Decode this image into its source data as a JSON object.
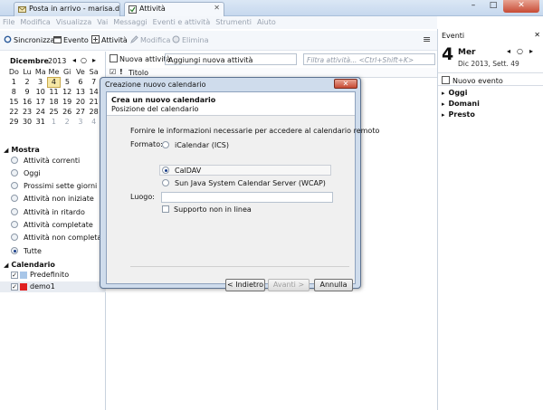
{
  "tabs": [
    {
      "label": "Posta in arrivo - marisa.dalla..."
    },
    {
      "label": "Attività"
    }
  ],
  "menubar": [
    "File",
    "Modifica",
    "Visualizza",
    "Vai",
    "Messaggi",
    "Eventi e attività",
    "Strumenti",
    "Aiuto"
  ],
  "toolbar": {
    "sync": "Sincronizza",
    "event": "Evento",
    "task": "Attività",
    "edit": "Modifica",
    "delete": "Elimina"
  },
  "minical": {
    "month": "Dicembre",
    "year": "2013",
    "weekdays": [
      "Do",
      "Lu",
      "Ma",
      "Me",
      "Gi",
      "Ve",
      "Sa"
    ],
    "weeks": [
      [
        "1",
        "2",
        "3",
        "4",
        "5",
        "6",
        "7"
      ],
      [
        "8",
        "9",
        "10",
        "11",
        "12",
        "13",
        "14"
      ],
      [
        "15",
        "16",
        "17",
        "18",
        "19",
        "20",
        "21"
      ],
      [
        "22",
        "23",
        "24",
        "25",
        "26",
        "27",
        "28"
      ],
      [
        "29",
        "30",
        "31",
        "1",
        "2",
        "3",
        "4"
      ]
    ],
    "today": "4"
  },
  "show": {
    "heading": "Mostra",
    "options": [
      "Attività correnti",
      "Oggi",
      "Prossimi sette giorni",
      "Attività non iniziate",
      "Attività in ritardo",
      "Attività completate",
      "Attività non completate",
      "Tutte"
    ],
    "selected": "Tutte"
  },
  "calendars": {
    "heading": "Calendario",
    "items": [
      {
        "name": "Predefinito",
        "color": "#a8c6e8"
      },
      {
        "name": "demo1",
        "color": "#e02020"
      }
    ]
  },
  "tasks": {
    "new_task": "Nuova attività",
    "add_field": "Aggiungi nuova attività",
    "filter_placeholder": "Filtra attività... <Ctrl+Shift+K>",
    "column_title": "Titolo"
  },
  "events": {
    "heading": "Eventi",
    "day_number": "4",
    "day_name": "Mer",
    "date_sub": "Dic 2013, Sett. 49",
    "new_event": "Nuovo evento",
    "groups": [
      "Oggi",
      "Domani",
      "Presto"
    ]
  },
  "dialog": {
    "title": "Creazione nuovo calendario",
    "heading": "Crea un nuovo calendario",
    "subheading": "Posizione del calendario",
    "info": "Fornire le informazioni necessarie per accedere al calendario remoto",
    "format_label": "Formato:",
    "formats": [
      "iCalendar (ICS)",
      "CalDAV",
      "Sun Java System Calendar Server (WCAP)"
    ],
    "selected_format": "CalDAV",
    "location_label": "Luogo:",
    "location_value": "",
    "offline_label": "Supporto non in linea",
    "back": "< Indietro",
    "next": "Avanti >",
    "cancel": "Annulla"
  }
}
